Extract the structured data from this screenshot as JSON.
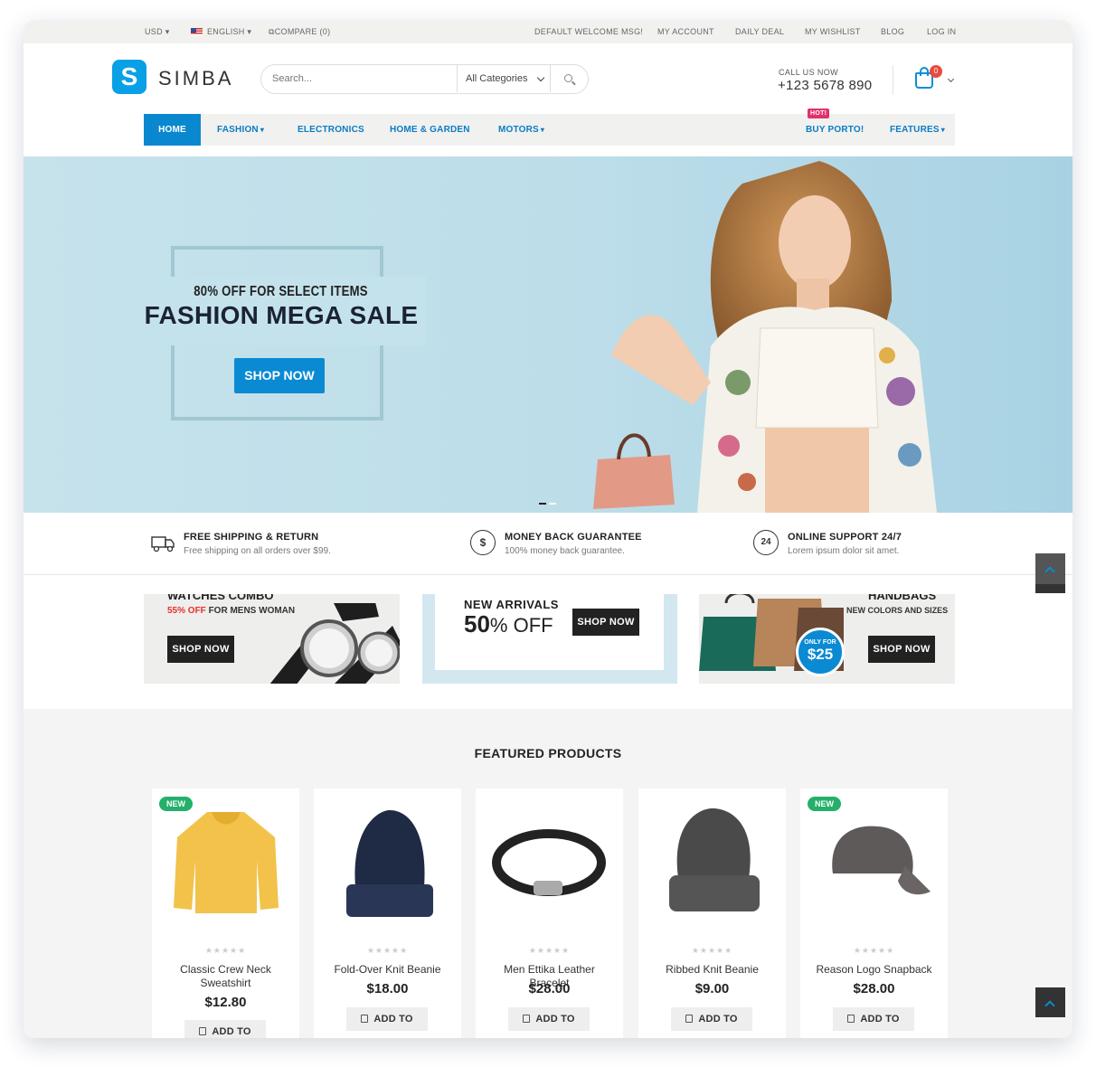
{
  "topbar": {
    "currency": "USD",
    "language": "ENGLISH",
    "compare": "COMPARE (0)",
    "links": [
      "DEFAULT WELCOME MSG!",
      "MY ACCOUNT",
      "DAILY DEAL",
      "MY WISHLIST",
      "BLOG",
      "LOG IN"
    ]
  },
  "header": {
    "logo_letter": "S",
    "logo_text": "SIMBA",
    "search_placeholder": "Search...",
    "category_select": "All Categories",
    "call_label": "CALL US NOW",
    "phone": "+123 5678 890",
    "cart_count": "0"
  },
  "nav": {
    "items": [
      "HOME",
      "FASHION",
      "ELECTRONICS",
      "HOME & GARDEN",
      "MOTORS",
      "BUY PORTO!",
      "FEATURES"
    ],
    "hot_badge": "HOT!"
  },
  "hero": {
    "subtitle": "80% OFF FOR SELECT ITEMS",
    "title": "FASHION MEGA SALE",
    "button": "SHOP NOW"
  },
  "features": [
    {
      "icon": "truck-icon",
      "title": "FREE SHIPPING & RETURN",
      "desc": "Free shipping on all orders over $99."
    },
    {
      "icon": "dollar-icon",
      "title": "MONEY BACK GUARANTEE",
      "desc": "100% money back guarantee."
    },
    {
      "icon": "support-24-icon",
      "glyph": "24",
      "title": "ONLINE SUPPORT 24/7",
      "desc": "Lorem ipsum dolor sit amet."
    }
  ],
  "banners": {
    "watches": {
      "title": "WATCHES COMBO",
      "discount": "55% OFF",
      "for_text": "FOR MENS WOMAN",
      "button": "SHOP NOW"
    },
    "arrivals": {
      "title": "NEW ARRIVALS",
      "amount": "50",
      "unit": "% OFF",
      "button": "SHOP NOW"
    },
    "handbags": {
      "title": "HANDBAGS",
      "subtitle": "NEW COLORS AND SIZES",
      "badge_top": "ONLY FOR",
      "badge_price": "$25",
      "button": "SHOP NOW"
    }
  },
  "featured": {
    "title": "FEATURED PRODUCTS",
    "add_to_cart": "ADD TO CART",
    "stars": "★★★★★",
    "new_badge": "NEW",
    "products": [
      {
        "name": "Classic Crew Neck Sweatshirt",
        "price": "$12.80",
        "new": true
      },
      {
        "name": "Fold-Over Knit Beanie",
        "price": "$18.00",
        "new": false
      },
      {
        "name": "Men Ettika Leather Bracelet",
        "price": "$28.00",
        "new": false
      },
      {
        "name": "Ribbed Knit Beanie",
        "price": "$9.00",
        "new": false
      },
      {
        "name": "Reason Logo Snapback",
        "price": "$28.00",
        "new": true
      }
    ]
  },
  "colors": {
    "brand": "#0a8ad3",
    "badge_new": "#24b06a",
    "badge_hot": "#e0316c",
    "cart_count": "#e84b3c"
  }
}
